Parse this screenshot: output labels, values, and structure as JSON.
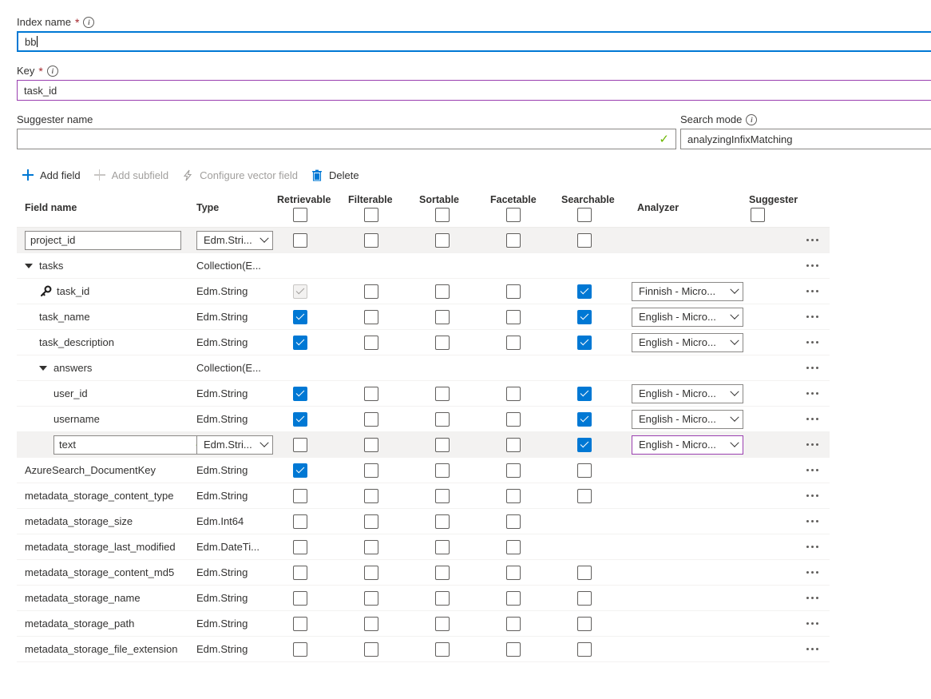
{
  "form": {
    "index_name": {
      "label": "Index name",
      "required_marker": "*",
      "info": "info-icon",
      "value": "bb"
    },
    "key": {
      "label": "Key",
      "required_marker": "*",
      "info": "info-icon",
      "value": "task_id"
    },
    "suggester_name": {
      "label": "Suggester name",
      "value": "",
      "validation_icon": "✓"
    },
    "search_mode": {
      "label": "Search mode",
      "info": "info-icon",
      "value": "analyzingInfixMatching"
    }
  },
  "toolbar": {
    "add_field": "Add field",
    "add_subfield": "Add subfield",
    "configure_vector_field": "Configure vector field",
    "delete": "Delete"
  },
  "table": {
    "columns": {
      "field_name": "Field name",
      "type": "Type",
      "retrievable": "Retrievable",
      "filterable": "Filterable",
      "sortable": "Sortable",
      "facetable": "Facetable",
      "searchable": "Searchable",
      "analyzer": "Analyzer",
      "suggester": "Suggester"
    },
    "header_checkboxes": {
      "retrievable": false,
      "filterable": false,
      "sortable": false,
      "facetable": false,
      "searchable": false,
      "suggester": false
    },
    "rows": [
      {
        "name": "project_id",
        "name_editable": true,
        "indent": 0,
        "type": "Edm.Stri...",
        "type_editable": true,
        "retrievable": false,
        "filterable": false,
        "sortable": false,
        "facetable": false,
        "searchable": false,
        "searchable_visible": true,
        "analyzer": null,
        "shaded": true,
        "menu": "..."
      },
      {
        "name": "tasks",
        "indent": 0,
        "expander": "▼",
        "type": "Collection(E...",
        "collection": true,
        "menu": "..."
      },
      {
        "name": "task_id",
        "indent": 1,
        "key_icon": true,
        "type": "Edm.String",
        "retrievable": true,
        "retrievable_disabled": true,
        "filterable": false,
        "sortable": false,
        "facetable": false,
        "searchable": true,
        "searchable_visible": true,
        "analyzer": "Finnish - Micro...",
        "menu": "..."
      },
      {
        "name": "task_name",
        "indent": 1,
        "type": "Edm.String",
        "retrievable": true,
        "filterable": false,
        "sortable": false,
        "facetable": false,
        "searchable": true,
        "searchable_visible": true,
        "analyzer": "English - Micro...",
        "menu": "..."
      },
      {
        "name": "task_description",
        "indent": 1,
        "type": "Edm.String",
        "retrievable": true,
        "filterable": false,
        "sortable": false,
        "facetable": false,
        "searchable": true,
        "searchable_visible": true,
        "analyzer": "English - Micro...",
        "menu": "..."
      },
      {
        "name": "answers",
        "indent": 1,
        "expander": "▼",
        "type": "Collection(E...",
        "collection": true,
        "menu": "..."
      },
      {
        "name": "user_id",
        "indent": 2,
        "type": "Edm.String",
        "retrievable": true,
        "filterable": false,
        "sortable": false,
        "facetable": false,
        "searchable": true,
        "searchable_visible": true,
        "analyzer": "English - Micro...",
        "menu": "..."
      },
      {
        "name": "username",
        "indent": 2,
        "type": "Edm.String",
        "retrievable": true,
        "filterable": false,
        "sortable": false,
        "facetable": false,
        "searchable": true,
        "searchable_visible": true,
        "analyzer": "English - Micro...",
        "menu": "..."
      },
      {
        "name": "text",
        "name_editable": true,
        "name_valid_icon": "✓",
        "indent": 2,
        "type": "Edm.Stri...",
        "type_editable": true,
        "retrievable": false,
        "filterable": false,
        "sortable": false,
        "facetable": false,
        "searchable": true,
        "searchable_visible": true,
        "analyzer": "English - Micro...",
        "analyzer_highlighted": true,
        "shaded": true,
        "menu": "..."
      },
      {
        "name": "AzureSearch_DocumentKey",
        "indent": 0,
        "type": "Edm.String",
        "retrievable": true,
        "filterable": false,
        "sortable": false,
        "facetable": false,
        "searchable": false,
        "searchable_visible": true,
        "analyzer": null,
        "menu": "..."
      },
      {
        "name": "metadata_storage_content_type",
        "indent": 0,
        "type": "Edm.String",
        "retrievable": false,
        "filterable": false,
        "sortable": false,
        "facetable": false,
        "searchable": false,
        "searchable_visible": true,
        "analyzer": null,
        "menu": "..."
      },
      {
        "name": "metadata_storage_size",
        "indent": 0,
        "type": "Edm.Int64",
        "retrievable": false,
        "filterable": false,
        "sortable": false,
        "facetable": false,
        "searchable_visible": false,
        "analyzer": null,
        "menu": "..."
      },
      {
        "name": "metadata_storage_last_modified",
        "indent": 0,
        "type": "Edm.DateTi...",
        "retrievable": false,
        "filterable": false,
        "sortable": false,
        "facetable": false,
        "searchable_visible": false,
        "analyzer": null,
        "menu": "..."
      },
      {
        "name": "metadata_storage_content_md5",
        "indent": 0,
        "type": "Edm.String",
        "retrievable": false,
        "filterable": false,
        "sortable": false,
        "facetable": false,
        "searchable": false,
        "searchable_visible": true,
        "analyzer": null,
        "menu": "..."
      },
      {
        "name": "metadata_storage_name",
        "indent": 0,
        "type": "Edm.String",
        "retrievable": false,
        "filterable": false,
        "sortable": false,
        "facetable": false,
        "searchable": false,
        "searchable_visible": true,
        "analyzer": null,
        "menu": "..."
      },
      {
        "name": "metadata_storage_path",
        "indent": 0,
        "type": "Edm.String",
        "retrievable": false,
        "filterable": false,
        "sortable": false,
        "facetable": false,
        "searchable": false,
        "searchable_visible": true,
        "analyzer": null,
        "menu": "..."
      },
      {
        "name": "metadata_storage_file_extension",
        "indent": 0,
        "type": "Edm.String",
        "retrievable": false,
        "filterable": false,
        "sortable": false,
        "facetable": false,
        "searchable": false,
        "searchable_visible": true,
        "analyzer": null,
        "menu": "..."
      }
    ]
  },
  "colors": {
    "accent": "#0078d4",
    "focus_border": "#0078d4",
    "purple_border": "#9a3fb0",
    "required_red": "#a4262c",
    "valid_green": "#6bb700",
    "shaded_row": "#f3f2f1"
  }
}
